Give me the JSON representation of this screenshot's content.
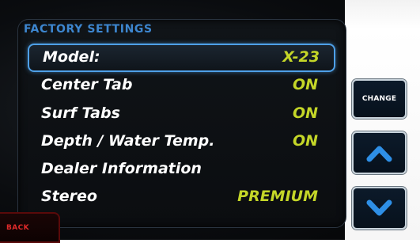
{
  "screen_title": "FACTORY SETTINGS",
  "settings": [
    {
      "label": "Model:",
      "value": "X-23"
    },
    {
      "label": "Center Tab",
      "value": "ON"
    },
    {
      "label": "Surf Tabs",
      "value": "ON"
    },
    {
      "label": "Depth / Water Temp.",
      "value": "ON"
    },
    {
      "label": "Dealer Information",
      "value": ""
    },
    {
      "label": "Stereo",
      "value": "PREMIUM"
    }
  ],
  "buttons": {
    "change_label": "CHANGE",
    "back_label": "BACK"
  },
  "icons": {
    "up": "chevron-up-icon",
    "down": "chevron-down-icon"
  },
  "colors": {
    "title": "#3d86cf",
    "value": "#c4d628",
    "label": "#ffffff",
    "highlight": "#4ea0e8",
    "back": "#e02a2a"
  }
}
